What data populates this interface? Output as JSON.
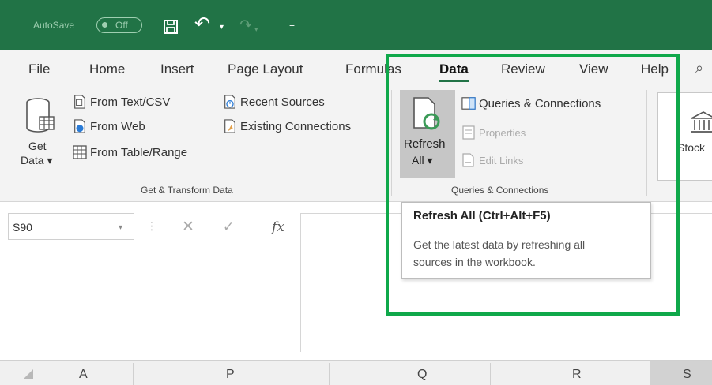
{
  "titlebar": {
    "autosave_label": "AutoSave",
    "autosave_state": "Off",
    "customize_glyph": "="
  },
  "tabs": [
    {
      "label": "File"
    },
    {
      "label": "Home"
    },
    {
      "label": "Insert"
    },
    {
      "label": "Page Layout"
    },
    {
      "label": "Formulas"
    },
    {
      "label": "Data",
      "active": true
    },
    {
      "label": "Review"
    },
    {
      "label": "View"
    },
    {
      "label": "Help"
    }
  ],
  "ribbon": {
    "get_transform": {
      "get_data_line1": "Get",
      "get_data_line2": "Data ▾",
      "from_text_csv": "From Text/CSV",
      "from_web": "From Web",
      "from_table_range": "From Table/Range",
      "recent_sources": "Recent Sources",
      "existing_connections": "Existing Connections",
      "group_label": "Get & Transform Data"
    },
    "queries": {
      "refresh_line1": "Refresh",
      "refresh_line2": "All ▾",
      "queries_connections": "Queries & Connections",
      "properties": "Properties",
      "edit_links": "Edit Links",
      "group_label": "Queries & Connections"
    },
    "data_types": {
      "stocks_label": "Stock"
    }
  },
  "formula_bar": {
    "name_box_value": "S90",
    "fx_label": "fx"
  },
  "tooltip": {
    "title": "Refresh All (Ctrl+Alt+F5)",
    "body_line1": "Get the latest data by refreshing all",
    "body_line2": "sources in the workbook."
  },
  "columns": {
    "a": "A",
    "p": "P",
    "q": "Q",
    "r": "R",
    "s": "S"
  },
  "colors": {
    "excel_green": "#217346",
    "highlight_green": "#0fa84a",
    "ribbon_bg": "#f3f3f3"
  }
}
